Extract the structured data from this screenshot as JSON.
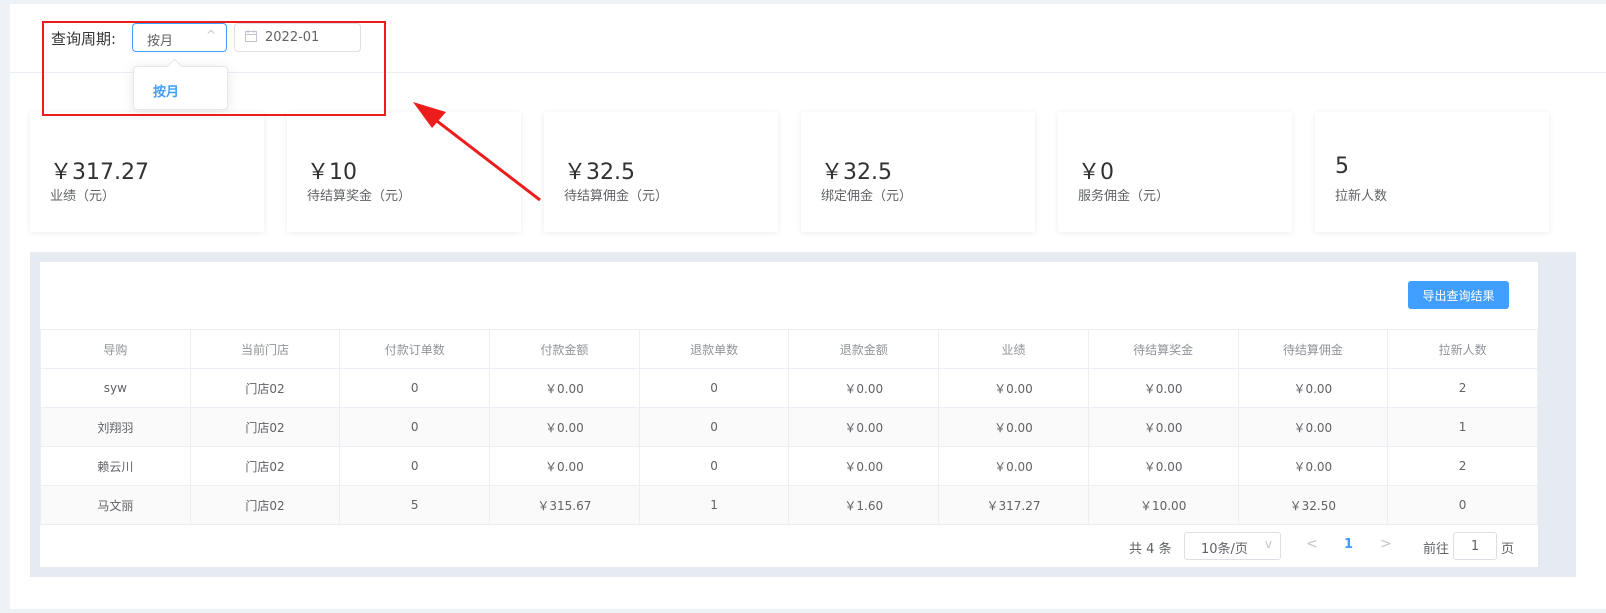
{
  "filter": {
    "label": "查询周期:",
    "period_selected": "按月",
    "chevron": "chevron-up-icon",
    "date_value": "2022-01",
    "dropdown_options": [
      "按月"
    ]
  },
  "stats": [
    {
      "amount": "￥317.27",
      "label": "业绩（元）"
    },
    {
      "amount": "￥10",
      "label": "待结算奖金（元）"
    },
    {
      "amount": "￥32.5",
      "label": "待结算佣金（元）"
    },
    {
      "amount": "￥32.5",
      "label": "绑定佣金（元）"
    },
    {
      "amount": "￥0",
      "label": "服务佣金（元）"
    },
    {
      "amount": "5",
      "label": "拉新人数"
    }
  ],
  "toolbar": {
    "export_label": "导出查询结果"
  },
  "table": {
    "columns": [
      "导购",
      "当前门店",
      "付款订单数",
      "付款金额",
      "退款单数",
      "退款金额",
      "业绩",
      "待结算奖金",
      "待结算佣金",
      "拉新人数"
    ],
    "rows": [
      [
        "syw",
        "门店02",
        "0",
        "￥0.00",
        "0",
        "￥0.00",
        "￥0.00",
        "￥0.00",
        "￥0.00",
        "2"
      ],
      [
        "刘翔羽",
        "门店02",
        "0",
        "￥0.00",
        "0",
        "￥0.00",
        "￥0.00",
        "￥0.00",
        "￥0.00",
        "1"
      ],
      [
        "赖云川",
        "门店02",
        "0",
        "￥0.00",
        "0",
        "￥0.00",
        "￥0.00",
        "￥0.00",
        "￥0.00",
        "2"
      ],
      [
        "马文丽",
        "门店02",
        "5",
        "￥315.67",
        "1",
        "￥1.60",
        "￥317.27",
        "￥10.00",
        "￥32.50",
        "0"
      ]
    ]
  },
  "pagination": {
    "total": "共 4 条",
    "page_size": "10条/页",
    "current_page": "1",
    "goto_label": "前往",
    "goto_value": "1",
    "page_suffix": "页"
  },
  "colors": {
    "accent": "#409eff",
    "annotation": "#ee1d1d"
  }
}
